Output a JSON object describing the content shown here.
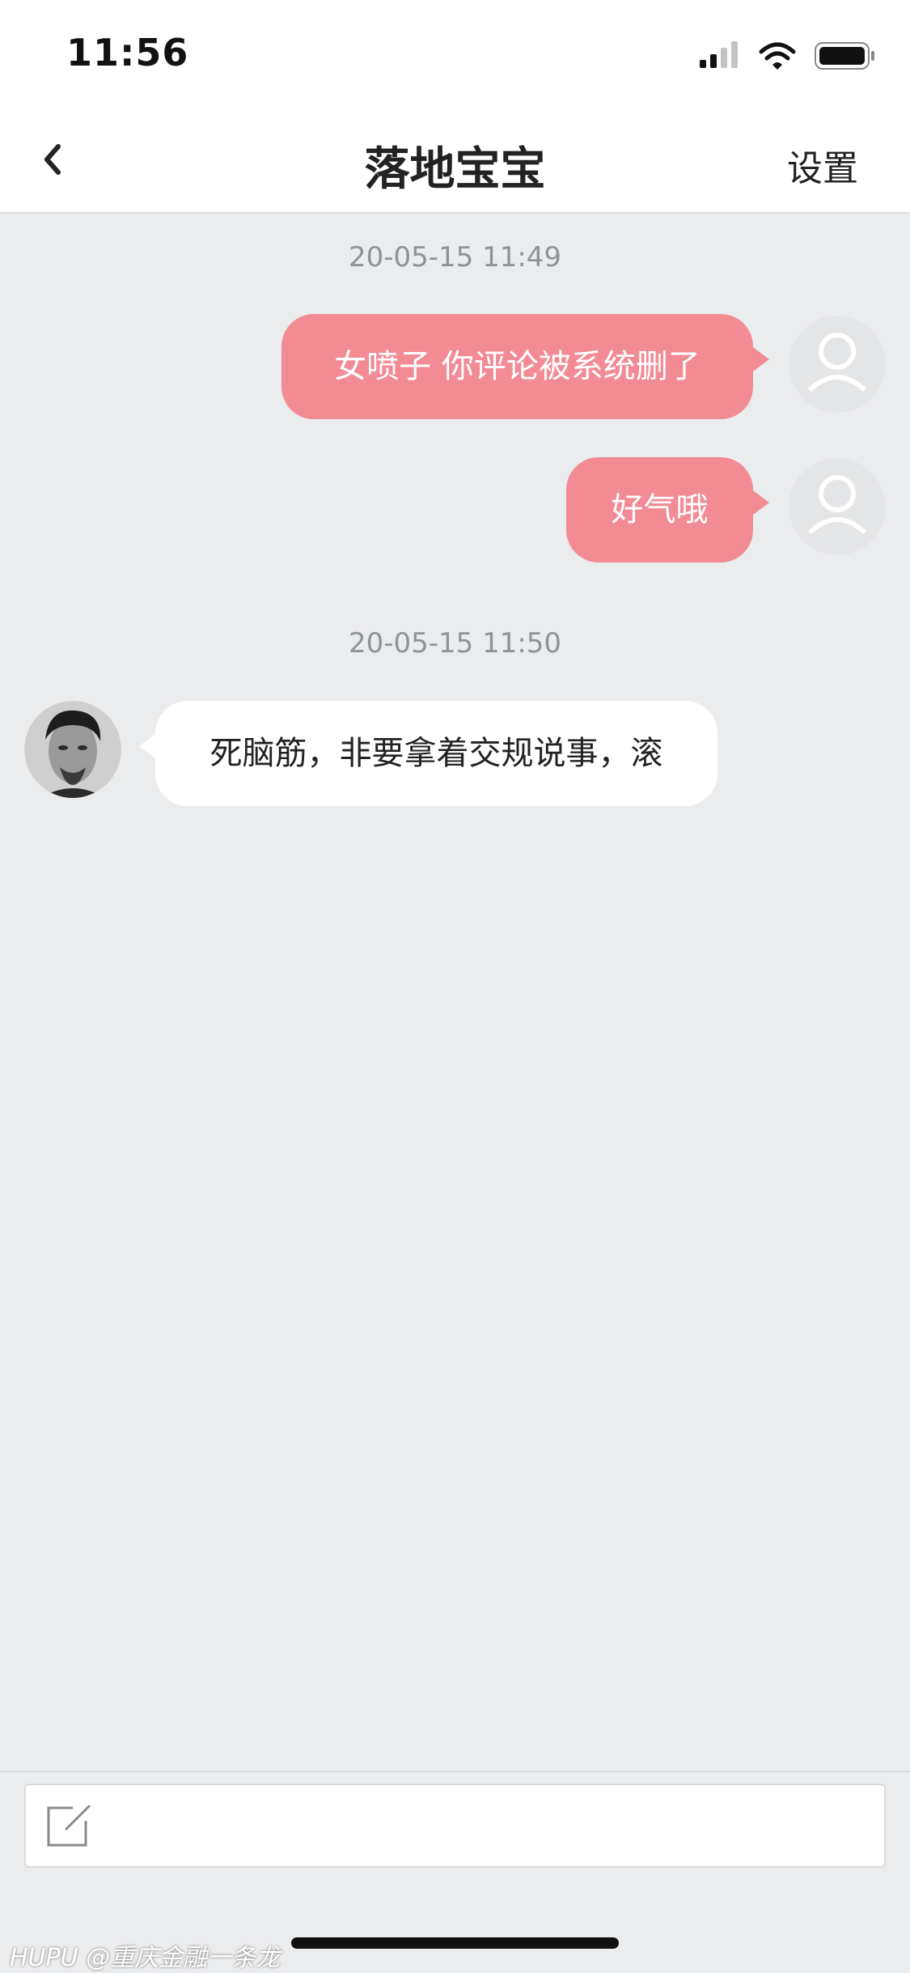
{
  "status_bar": {
    "time": "11:56"
  },
  "nav": {
    "title": "落地宝宝",
    "settings_label": "设置"
  },
  "messages": [
    {
      "timestamp": "20-05-15 11:49"
    },
    {
      "text": "女喷子 你评论被系统删了",
      "direction": "outgoing"
    },
    {
      "text": "好气哦",
      "direction": "outgoing"
    },
    {
      "timestamp": "20-05-15 11:50"
    },
    {
      "text": "死脑筋，非要拿着交规说事，滚",
      "direction": "incoming"
    }
  ],
  "input": {
    "icon": "compose-icon"
  },
  "watermark": "HUPU @重庆金融一条龙",
  "colors": {
    "outgoing_bubble": "#f38b94",
    "incoming_bubble": "#ffffff",
    "chat_background": "#ebecee",
    "timestamp_text": "#8f9297"
  }
}
